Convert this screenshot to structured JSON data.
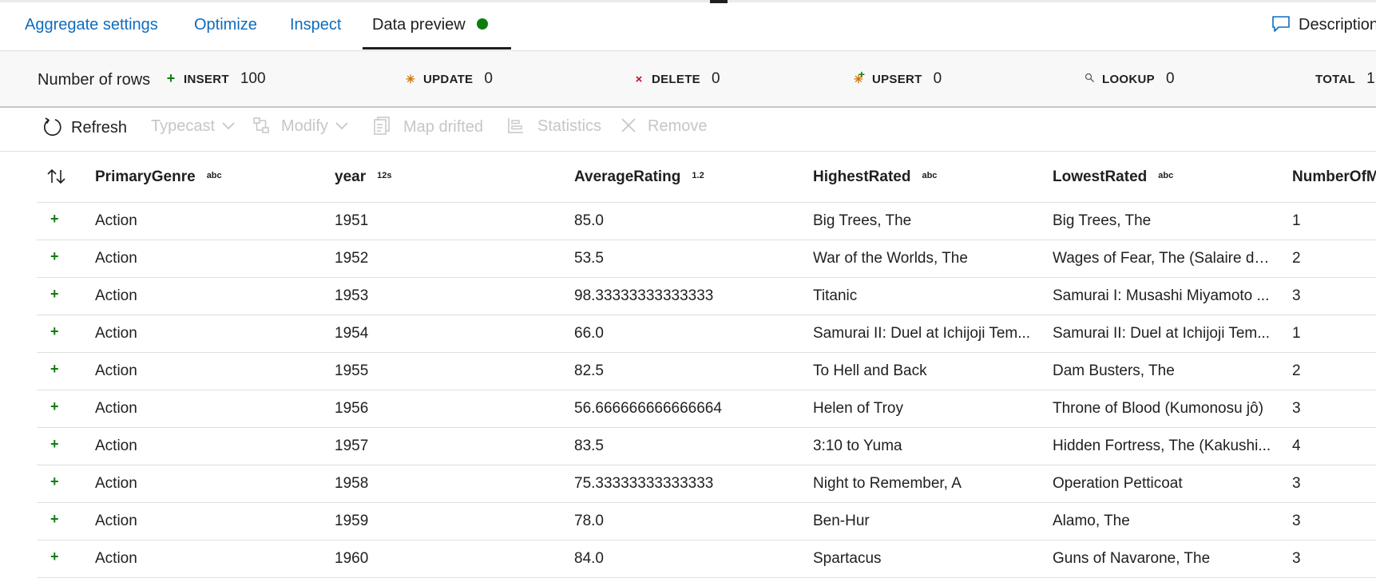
{
  "tabs": [
    {
      "label": "Aggregate settings"
    },
    {
      "label": "Optimize"
    },
    {
      "label": "Inspect"
    },
    {
      "label": "Data preview"
    }
  ],
  "description_label": "Description",
  "stats": {
    "label": "Number of rows",
    "insert": {
      "key": "INSERT",
      "value": "100"
    },
    "update": {
      "key": "UPDATE",
      "value": "0"
    },
    "delete": {
      "key": "DELETE",
      "value": "0"
    },
    "upsert": {
      "key": "UPSERT",
      "value": "0"
    },
    "lookup": {
      "key": "LOOKUP",
      "value": "0"
    },
    "total": {
      "key": "TOTAL",
      "value": "1"
    }
  },
  "toolbar": {
    "refresh": "Refresh",
    "typecast": "Typecast",
    "modify": "Modify",
    "map_drifted": "Map drifted",
    "statistics": "Statistics",
    "remove": "Remove"
  },
  "columns": [
    {
      "name": "PrimaryGenre",
      "type": "abc"
    },
    {
      "name": "year",
      "type": "12s"
    },
    {
      "name": "AverageRating",
      "type": "1.2"
    },
    {
      "name": "HighestRated",
      "type": "abc"
    },
    {
      "name": "LowestRated",
      "type": "abc"
    },
    {
      "name": "NumberOfM",
      "type": ""
    }
  ],
  "rows": [
    [
      "Action",
      "1951",
      "85.0",
      "Big Trees, The",
      "Big Trees, The",
      "1"
    ],
    [
      "Action",
      "1952",
      "53.5",
      "War of the Worlds, The",
      "Wages of Fear, The (Salaire de...",
      "2"
    ],
    [
      "Action",
      "1953",
      "98.33333333333333",
      "Titanic",
      "Samurai I: Musashi Miyamoto ...",
      "3"
    ],
    [
      "Action",
      "1954",
      "66.0",
      "Samurai II: Duel at Ichijoji Tem...",
      "Samurai II: Duel at Ichijoji Tem...",
      "1"
    ],
    [
      "Action",
      "1955",
      "82.5",
      "To Hell and Back",
      "Dam Busters, The",
      "2"
    ],
    [
      "Action",
      "1956",
      "56.666666666666664",
      "Helen of Troy",
      "Throne of Blood (Kumonosu jô)",
      "3"
    ],
    [
      "Action",
      "1957",
      "83.5",
      "3:10 to Yuma",
      "Hidden Fortress, The (Kakushi...",
      "4"
    ],
    [
      "Action",
      "1958",
      "75.33333333333333",
      "Night to Remember, A",
      "Operation Petticoat",
      "3"
    ],
    [
      "Action",
      "1959",
      "78.0",
      "Ben-Hur",
      "Alamo, The",
      "3"
    ],
    [
      "Action",
      "1960",
      "84.0",
      "Spartacus",
      "Guns of Navarone, The",
      "3"
    ]
  ],
  "colors": {
    "accent": "#0f6cbd",
    "insert": "#107c10",
    "update": "#d47500",
    "delete": "#c50f1f"
  }
}
